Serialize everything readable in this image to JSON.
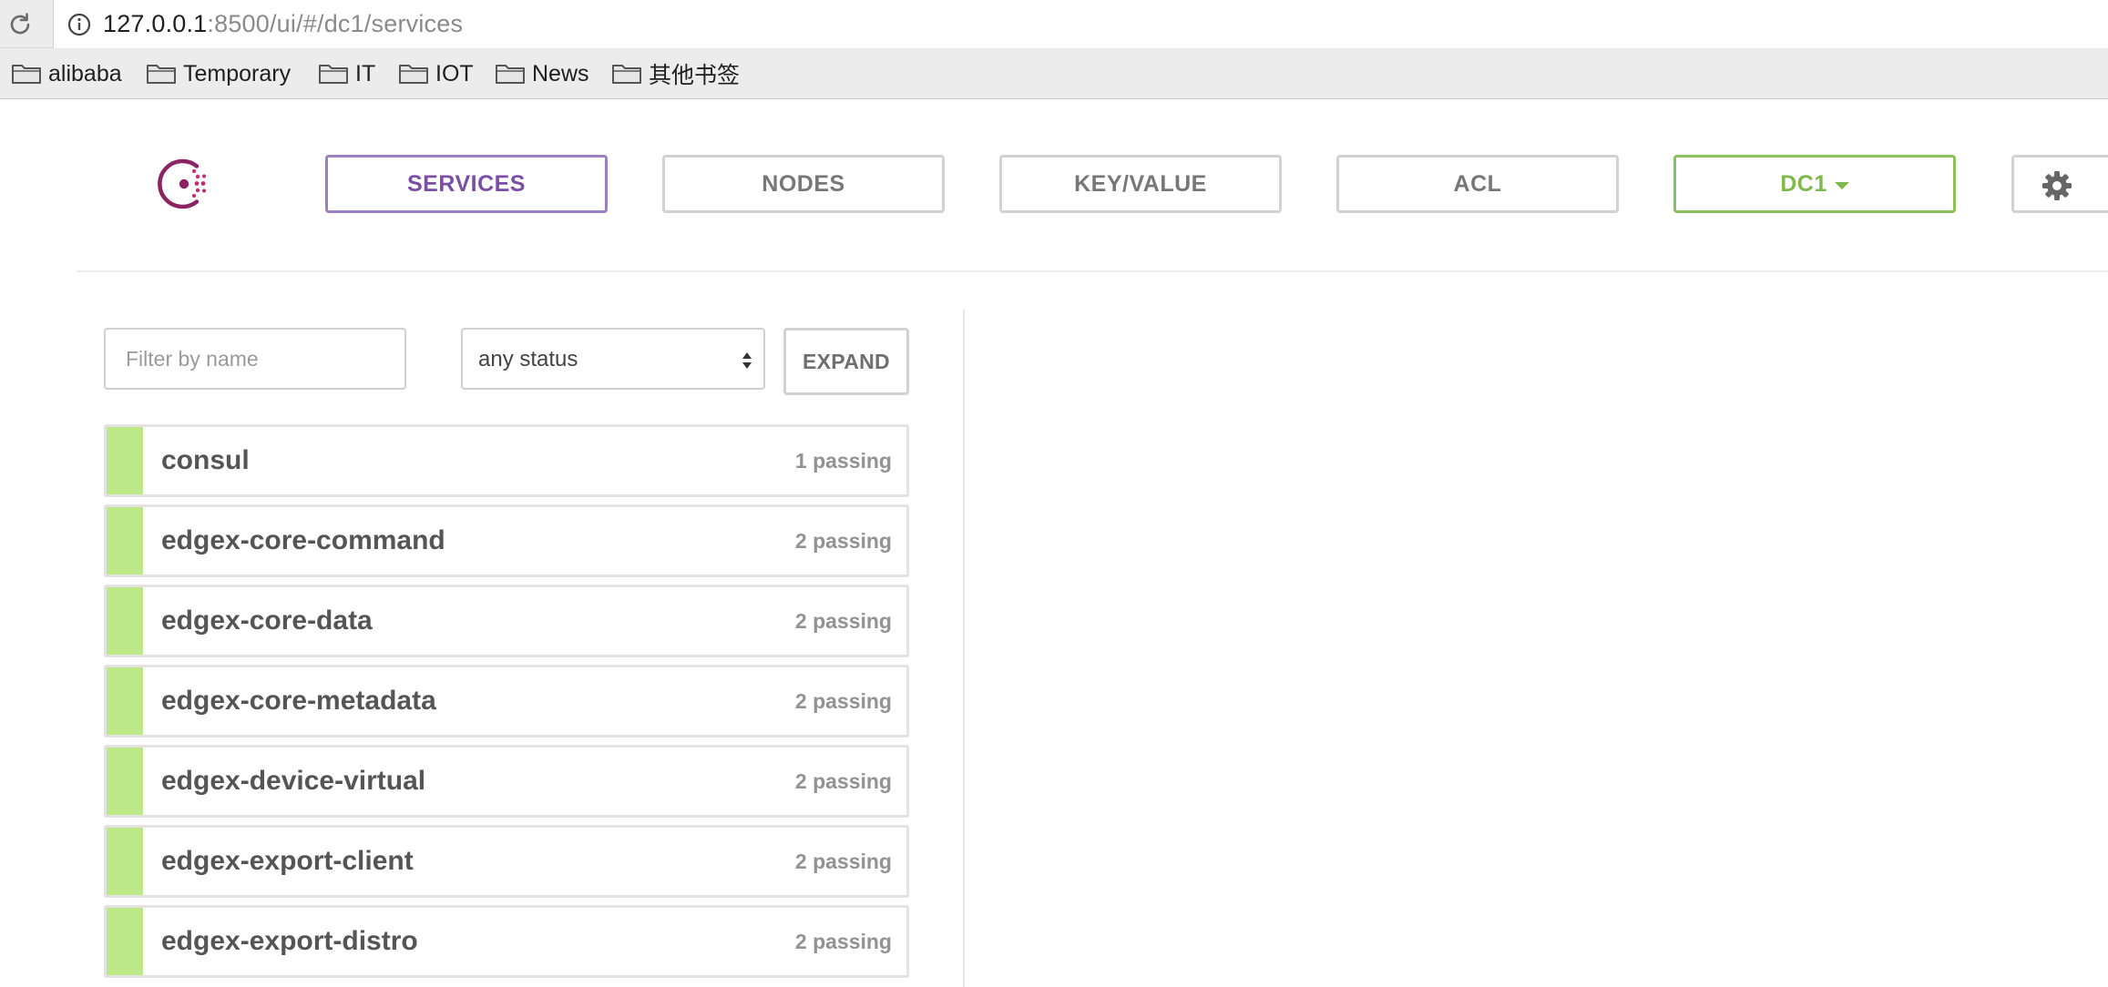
{
  "browser": {
    "url_host": "127.0.0.1",
    "url_rest": ":8500/ui/#/dc1/services",
    "bookmarks": [
      {
        "label": "alibaba"
      },
      {
        "label": "Temporary"
      },
      {
        "label": "IT"
      },
      {
        "label": "IOT"
      },
      {
        "label": "News"
      },
      {
        "label": "其他书签"
      }
    ]
  },
  "nav": {
    "services": "SERVICES",
    "nodes": "NODES",
    "key_value": "KEY/VALUE",
    "acl": "ACL",
    "datacenter": "DC1"
  },
  "filters": {
    "name_placeholder": "Filter by name",
    "status_value": "any status",
    "expand_label": "EXPAND"
  },
  "services": [
    {
      "name": "consul",
      "status": "1 passing"
    },
    {
      "name": "edgex-core-command",
      "status": "2 passing"
    },
    {
      "name": "edgex-core-data",
      "status": "2 passing"
    },
    {
      "name": "edgex-core-metadata",
      "status": "2 passing"
    },
    {
      "name": "edgex-device-virtual",
      "status": "2 passing"
    },
    {
      "name": "edgex-export-client",
      "status": "2 passing"
    },
    {
      "name": "edgex-export-distro",
      "status": "2 passing"
    }
  ],
  "colors": {
    "passing": "#bde887",
    "active_nav": "#7b4fa3",
    "datacenter": "#80b84e",
    "logo": "#8b2463"
  }
}
